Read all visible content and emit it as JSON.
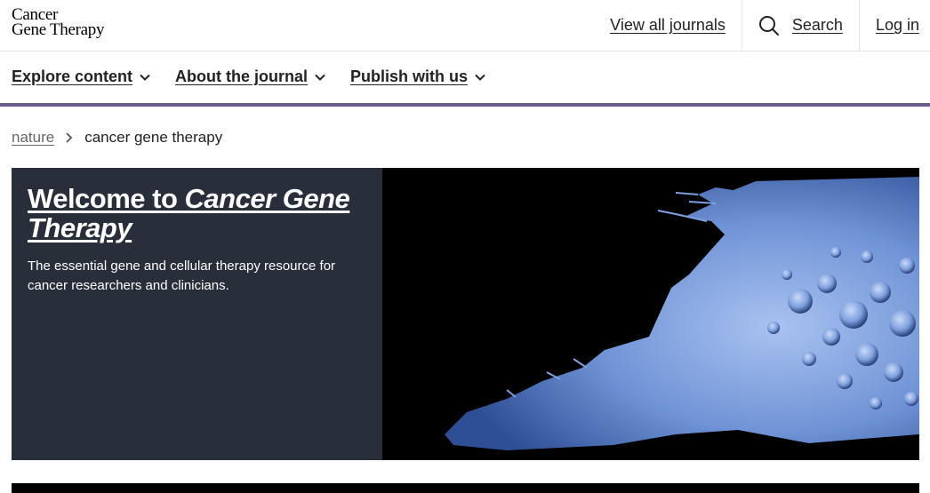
{
  "header": {
    "logo_line1": "Cancer",
    "logo_line2": "Gene Therapy",
    "view_all_journals": "View all journals",
    "search": "Search",
    "login": "Log in"
  },
  "nav": {
    "items": [
      {
        "label": "Explore content"
      },
      {
        "label": "About the journal"
      },
      {
        "label": "Publish with us"
      }
    ]
  },
  "breadcrumb": {
    "root": "nature",
    "current": "cancer gene therapy"
  },
  "hero": {
    "title_prefix": "Welcome to ",
    "title_italic": "Cancer Gene Therapy",
    "description": "The essential gene and cellular therapy resource for cancer researchers and clinicians."
  },
  "colors": {
    "accent": "#6b5a8e",
    "hero_panel": "#282e3a",
    "cell_blue": "#6f93d6"
  }
}
